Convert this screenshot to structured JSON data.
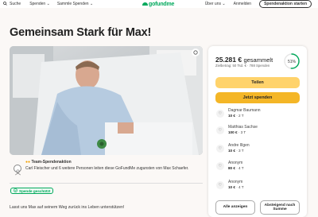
{
  "header": {
    "search": "Suche",
    "donate": "Spenden",
    "collect": "Sammle Spenden",
    "logo": "gofundme",
    "about": "Über uns",
    "login": "Anmelden",
    "start": "Spendenaktion starten"
  },
  "page": {
    "title": "Gemeinsam Stark für Max!",
    "team_label": "Team-Spendenaktion",
    "organizer_text": "Carl Fleischer und 6 weitere Personen leiten diese GoFundMe zugunsten von Max Schaefer.",
    "protected_badge": "Spende geschützt",
    "story_start": "Lasst uns Max auf seinem Weg zurück ins Leben unterstützen!"
  },
  "panel": {
    "amount": "25.281 €",
    "amount_suffix": "gesammelt",
    "goal_text": "Zielbetrag: 50 Tsd. € · 788 Spenden",
    "progress_label": "51%",
    "progress_value": 51,
    "share_label": "Teilen",
    "donate_label": "Jetzt spenden",
    "donations": [
      {
        "name": "Dagmar Baumann",
        "amount": "10 €",
        "time": "2 T"
      },
      {
        "name": "Matthias Sachse",
        "amount": "100 €",
        "time": "3 T"
      },
      {
        "name": "Andre Illgen",
        "amount": "10 €",
        "time": "3 T"
      },
      {
        "name": "Anonym",
        "amount": "80 €",
        "time": "4 T"
      },
      {
        "name": "Anonym",
        "amount": "10 €",
        "time": "4 T"
      }
    ],
    "show_all": "Alle anzeigen",
    "sort_label": "Absteigend nach Summe"
  },
  "colors": {
    "brand": "#02a95c",
    "share": "#ffd36b",
    "donate": "#f4b627"
  }
}
